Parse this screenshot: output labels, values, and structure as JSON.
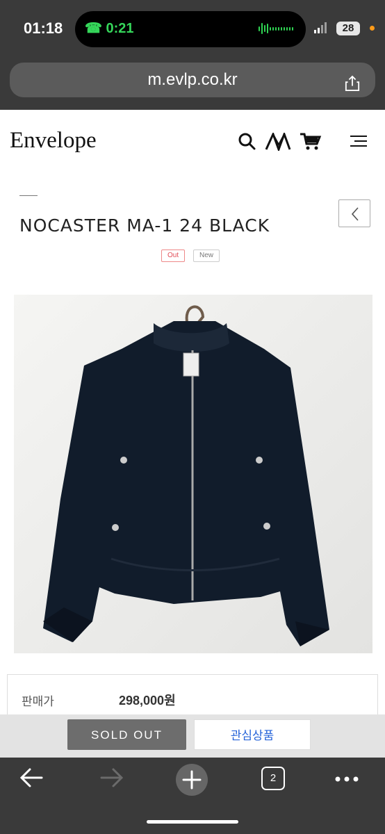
{
  "status": {
    "time": "01:18",
    "call_time": "0:21",
    "battery": "28"
  },
  "browser": {
    "url": "m.evlp.co.kr",
    "tab_count": "2"
  },
  "site": {
    "logo": "Envelope"
  },
  "product": {
    "title": "NOCASTER MA-1 24 BLACK",
    "badges": [
      "Out",
      "New"
    ],
    "price_label": "판매가",
    "price": "298,000원"
  },
  "buttons": {
    "sold_out": "SOLD OUT",
    "wishlist": "관심상품"
  },
  "colors": {
    "call_green": "#35d65a",
    "wishlist_blue": "#2563d9",
    "badge_red": "#e14b55"
  },
  "icons": [
    "back-arrow-icon",
    "forward-arrow-icon",
    "new-tab-icon",
    "tabs-icon",
    "more-icon",
    "search-icon",
    "brand-mark-icon",
    "cart-icon",
    "menu-icon",
    "share-icon"
  ]
}
